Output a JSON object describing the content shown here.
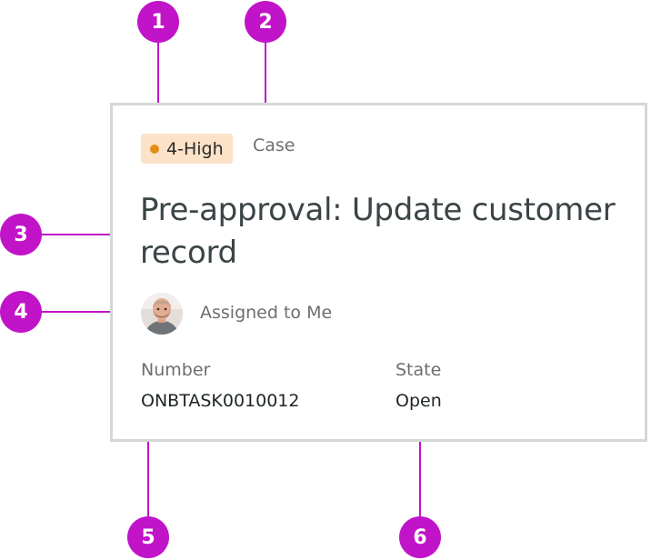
{
  "callouts": [
    "1",
    "2",
    "3",
    "4",
    "5",
    "6"
  ],
  "colors": {
    "callout": "#c114c8",
    "card_border": "#d3d8d6",
    "priority_background": "#fbe2c8",
    "priority_dot": "#e58d18"
  },
  "card": {
    "priority": {
      "label": "4-High",
      "icon": "priority-dot-icon"
    },
    "record_type": "Case",
    "title": "Pre-approval: Update customer record",
    "assignee": {
      "avatar_icon": "user-avatar",
      "label": "Assigned to Me"
    },
    "fields": [
      {
        "label": "Number",
        "value": "ONBTASK0010012"
      },
      {
        "label": "State",
        "value": "Open"
      }
    ]
  }
}
